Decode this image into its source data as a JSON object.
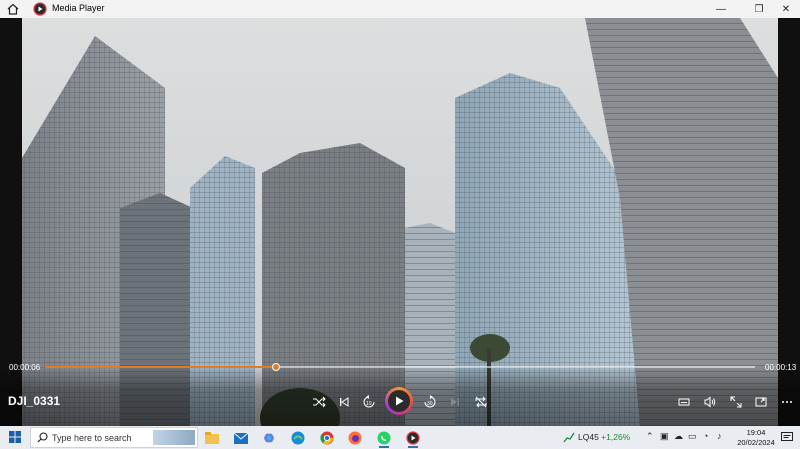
{
  "window": {
    "title": "Media Player",
    "minimize_glyph": "—",
    "maximize_glyph": "❐",
    "close_glyph": "✕"
  },
  "player": {
    "elapsed": "00:00:06",
    "total": "00:00:13",
    "progress_fraction": 0.325,
    "file_title": "DJI_0331",
    "accent_color": "#e07b2a",
    "controls": [
      "shuffle-icon",
      "previous-icon",
      "rewind-10-icon",
      "play-icon",
      "forward-30-icon",
      "next-icon",
      "repeat-off-icon",
      "miniplayer-icon",
      "volume-icon",
      "fullscreen-icon",
      "cast-icon",
      "more-icon"
    ],
    "rewind_label": "10",
    "forward_label": "30"
  },
  "taskbar": {
    "search_placeholder": "Type here to search",
    "apps": [
      "file-explorer-icon",
      "mail-icon",
      "copilot-icon",
      "edge-icon",
      "chrome-icon",
      "firefox-icon",
      "whatsapp-icon",
      "media-player-icon"
    ],
    "stock_symbol": "LQ45",
    "stock_change": "+1,26%",
    "stock_color": "#1a8a3a",
    "time": "19:04",
    "date": "20/02/2024"
  }
}
